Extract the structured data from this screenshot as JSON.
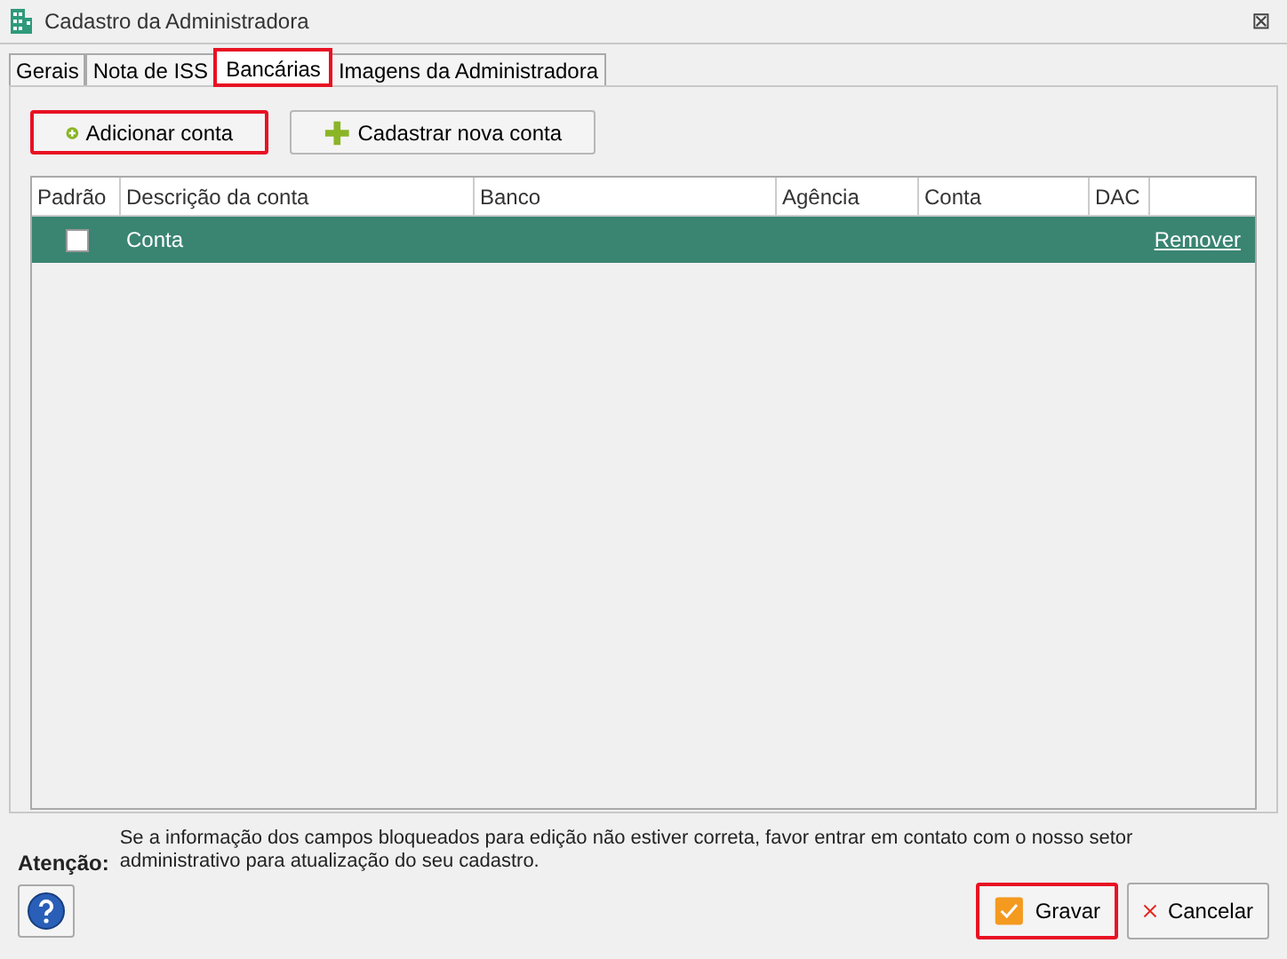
{
  "window": {
    "title": "Cadastro da Administradora",
    "close": "⊠"
  },
  "tabs": [
    {
      "label": "Gerais",
      "selected": false,
      "highlighted": false
    },
    {
      "label": "Nota de ISS",
      "selected": false,
      "highlighted": false
    },
    {
      "label": "Bancárias",
      "selected": true,
      "highlighted": true
    },
    {
      "label": "Imagens da Administradora",
      "selected": false,
      "highlighted": false
    }
  ],
  "toolbar": [
    {
      "label": "Adicionar conta",
      "kind": "add",
      "highlighted": true
    },
    {
      "label": "Cadastrar nova conta",
      "kind": "new",
      "highlighted": false
    }
  ],
  "table": {
    "columns": [
      "Padrão",
      "Descrição da conta",
      "Banco",
      "Agência",
      "Conta",
      "DAC"
    ],
    "rows": [
      {
        "checked": false,
        "description": "Conta",
        "action": "Remover",
        "selected": true
      }
    ]
  },
  "notice": {
    "label": "Atenção:",
    "text": "Se a informação dos campos bloqueados para edição não estiver correta, favor entrar em contato com o nosso setor administrativo para atualização do seu cadastro."
  },
  "buttons": [
    {
      "label": "Gravar",
      "kind": "save",
      "highlighted": true
    },
    {
      "label": "Cancelar",
      "kind": "cancel",
      "highlighted": false
    }
  ]
}
